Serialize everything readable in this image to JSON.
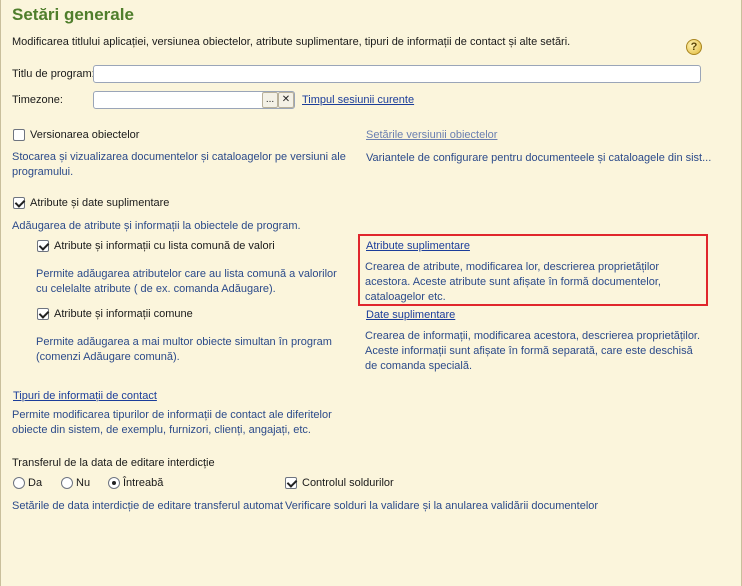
{
  "title": "Setări generale",
  "subtitle": "Modificarea titlului aplicației, versiunea obiectelor, atribute suplimentare, tipuri de informații de contact și alte setări.",
  "help_label": "?",
  "program_title": {
    "label": "Titlu de program:",
    "value": ""
  },
  "timezone": {
    "label": "Timezone:",
    "value": "",
    "select_button": "...",
    "clear_button": "✕",
    "session_link": "Timpul sesiunii curente"
  },
  "versioning": {
    "checkbox_label": "Versionarea obiectelor",
    "checked": false,
    "desc": "Stocarea și vizualizarea documentelor și cataloagelor pe versiuni ale programului.",
    "settings_link": "Setările versiunii obiectelor",
    "settings_desc": "Variantele de configurare pentru documenteele și cataloagele din sist..."
  },
  "attributes": {
    "checkbox_label": "Atribute și date suplimentare",
    "checked": true,
    "desc": "Adăugarea de atribute și informații la obiectele de program.",
    "common_list": {
      "checkbox_label": "Atribute și informații cu lista comună de valori",
      "checked": true,
      "desc": "Permite adăugarea atributelor care au lista comună a valorilor cu celelalte atribute ( de ex. comanda Adăugare)."
    },
    "additional_link": "Atribute suplimentare",
    "additional_desc": "Crearea de atribute, modificarea lor, descrierea proprietăților acestora. Aceste atribute sunt afișate în formă documentelor, cataloagelor etc.",
    "common": {
      "checkbox_label": "Atribute și informații comune",
      "checked": true,
      "desc": "Permite adăugarea a mai multor obiecte simultan în program (comenzi Adăugare comună)."
    },
    "data_link": "Date suplimentare",
    "data_desc": "Crearea de informații, modificarea acestora, descrierea proprietăților. Aceste informații sunt afișate în formă separată, care este deschisă de comanda specială."
  },
  "contact": {
    "link": "Tipuri de informații de contact",
    "desc": "Permite modificarea tipurilor de informații de contact ale diferitelor obiecte din sistem, de exemplu, furnizori, clienți, angajați, etc."
  },
  "transfer": {
    "label": "Transferul de la data de editare interdicție",
    "options": [
      "Da",
      "Nu",
      "Întreabă"
    ],
    "selected": "Întreabă",
    "desc": "Setările de data interdicție de editare transferul automat",
    "balance_checkbox": "Controlul soldurilor",
    "balance_checked": true,
    "balance_desc": "Verificare solduri la validare și la anularea validării documentelor"
  }
}
